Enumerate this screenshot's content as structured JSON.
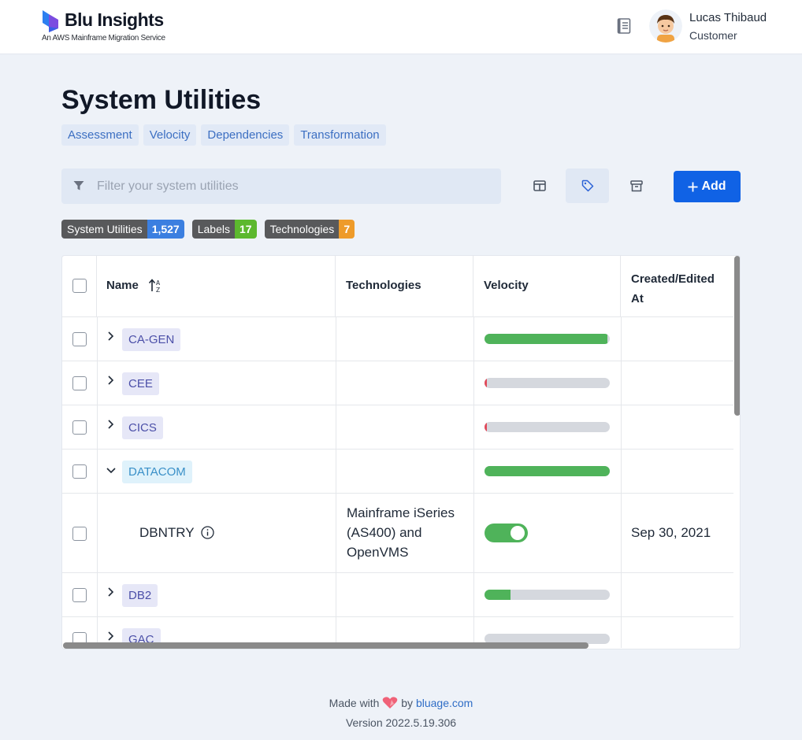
{
  "header": {
    "logo_title": "Blu Insights",
    "logo_subtitle": "An AWS Mainframe Migration Service",
    "user_name": "Lucas Thibaud",
    "user_role": "Customer"
  },
  "page": {
    "title": "System Utilities",
    "tabs": [
      "Assessment",
      "Velocity",
      "Dependencies",
      "Transformation"
    ]
  },
  "toolbar": {
    "filter_placeholder": "Filter your system utilities",
    "add_label": "Add"
  },
  "counters": [
    {
      "label": "System Utilities",
      "value": "1,527",
      "color": "#3b7fe0"
    },
    {
      "label": "Labels",
      "value": "17",
      "color": "#5cb82e"
    },
    {
      "label": "Technologies",
      "value": "7",
      "color": "#ee9b2a"
    }
  ],
  "table": {
    "columns": [
      "Name",
      "Technologies",
      "Velocity",
      "Created/Edited At"
    ],
    "rows": [
      {
        "name": "CA-GEN",
        "expanded": false,
        "velocity": 0.98
      },
      {
        "name": "CEE",
        "expanded": false,
        "velocity": 0.0
      },
      {
        "name": "CICS",
        "expanded": false,
        "velocity": 0.0
      },
      {
        "name": "DATACOM",
        "expanded": true,
        "velocity": 1.0,
        "children": [
          {
            "name": "DBNTRY",
            "technologies": "Mainframe iSeries (AS400) and OpenVMS",
            "velocity_enabled": true,
            "created_at": "Sep 30, 2021"
          }
        ]
      },
      {
        "name": "DB2",
        "expanded": false,
        "velocity": 0.21
      },
      {
        "name": "GAC",
        "expanded": false,
        "velocity": 0.0
      }
    ]
  },
  "footer": {
    "made_with": "Made with",
    "by": "by",
    "link": "bluage.com",
    "version": "Version 2022.5.19.306"
  }
}
